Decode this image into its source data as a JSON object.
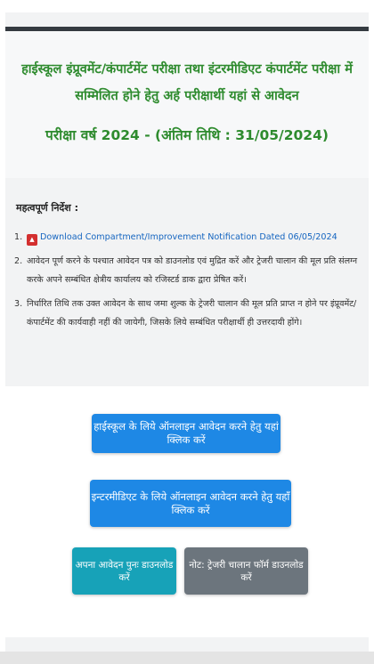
{
  "header": {
    "title": "हाईस्कूल इंप्रूवमेंट/कंपार्टमेंट परीक्षा तथा इंटरमीडिएट कंपार्टमेंट परीक्षा में सम्मिलित होने हेतु अर्ह परीक्षार्थी यहां से आवेदन",
    "exam_year": "परीक्षा वर्ष 2024 - (अंतिम तिथि : 31/05/2024)"
  },
  "instructions": {
    "heading": "महत्वपूर्ण निर्देश :",
    "items": [
      {
        "num": "1.",
        "icon": "pdf-icon",
        "text": "Download Compartment/Improvement Notification Dated 06/05/2024"
      },
      {
        "num": "2.",
        "text": "आवेदन पूर्ण करने के पश्चात आवेदन पत्र को डाउनलोड एवं मुद्रित करें और ट्रेजरी चालान की मूल प्रति संलग्न करके अपने सम्बंधित क्षेत्रीय कार्यालय को रजिस्टर्ड डाक द्वारा प्रेषित करें।"
      },
      {
        "num": "3.",
        "text": "निर्धारित तिथि तक उक्त आवेदन के साथ जमा शुल्क के ट्रेजरी चालान की मूल प्रति प्राप्त न होने पर इंप्रूवमेंट/कंपार्टमेंट की कार्यवाही नहीं की जायेगी, जिसके लिये सम्बंधित परीक्षार्थी ही उत्तरदायी होंगे।"
      }
    ]
  },
  "actions": {
    "highschool_button": "हाईस्कूल के लिये ऑनलाइन आवेदन करने हेतु यहां क्लिक करें",
    "intermediate_button": "इन्टरमीडिएट के लिये ऑनलाइन आवेदन करने हेतु यहाँ क्लिक करें",
    "redownload_button": "अपना आवेदन पुनः डाउनलोड करें",
    "treasury_challan_button": "नोट: ट्रेजरी चालान फॉर्म डाउनलोड करें"
  },
  "colors": {
    "title_green": "#2e8b2e",
    "primary_blue": "#1e88e5",
    "info_teal": "#17a2b8",
    "secondary_gray": "#6c757d"
  }
}
